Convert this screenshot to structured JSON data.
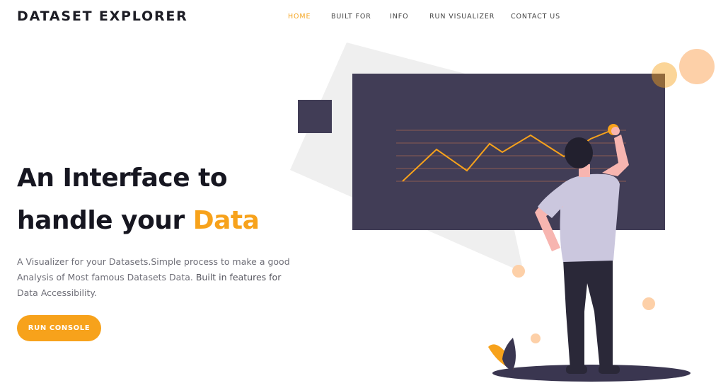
{
  "brand": {
    "name": "DATASET EXPLORER"
  },
  "nav": {
    "items": [
      {
        "label": "HOME",
        "active": true
      },
      {
        "label": "BUILT FOR",
        "active": false
      },
      {
        "label": "INFO",
        "active": false
      },
      {
        "label": "RUN VISUALIZER",
        "active": false
      },
      {
        "label": "CONTACT US",
        "active": false
      }
    ]
  },
  "hero": {
    "title_line1": "An Interface to",
    "title_line2_prefix": "handle your ",
    "title_line2_accent": "Data",
    "description_line1": "A Visualizer for your Datasets.Simple process to make a good",
    "description_line2_prefix": "Analysis of Most famous Datasets Data. ",
    "description_line2_emph": "Built in features for",
    "description_line3": "Data Accessibility.",
    "cta_label": "RUN CONSOLE"
  },
  "colors": {
    "accent": "#f7a21b",
    "nav_active": "#f5a623",
    "board": "#413d56",
    "shirt": "#cbc7de",
    "skin": "#f7b5b0",
    "hair": "#22202e",
    "pants": "#2a2838",
    "circle_light": "#fdd0a8",
    "backdrop": "#efefef"
  },
  "icons": {
    "illustration": "data-analyst-illustration"
  }
}
